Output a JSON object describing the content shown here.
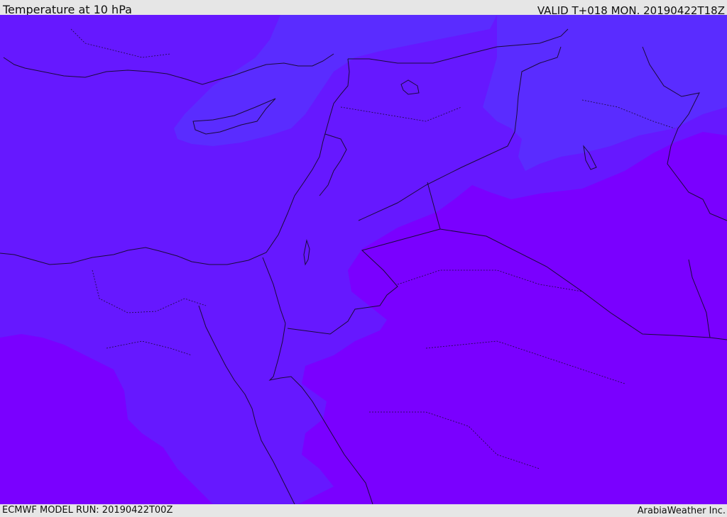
{
  "header": {
    "title": "Temperature at 10 hPa",
    "valid": "VALID T+018 MON. 20190422T18Z"
  },
  "footer": {
    "model_run": "ECMWF MODEL RUN: 20190422T00Z",
    "credit": "ArabiaWeather Inc."
  },
  "colors": {
    "band_cool": "#5a2cff",
    "band_mid": "#6618ff",
    "band_warm": "#7a00ff",
    "coastline": "#1a0a3a",
    "border": "#1a0a3a",
    "frame_bg": "#e6e6e6"
  }
}
